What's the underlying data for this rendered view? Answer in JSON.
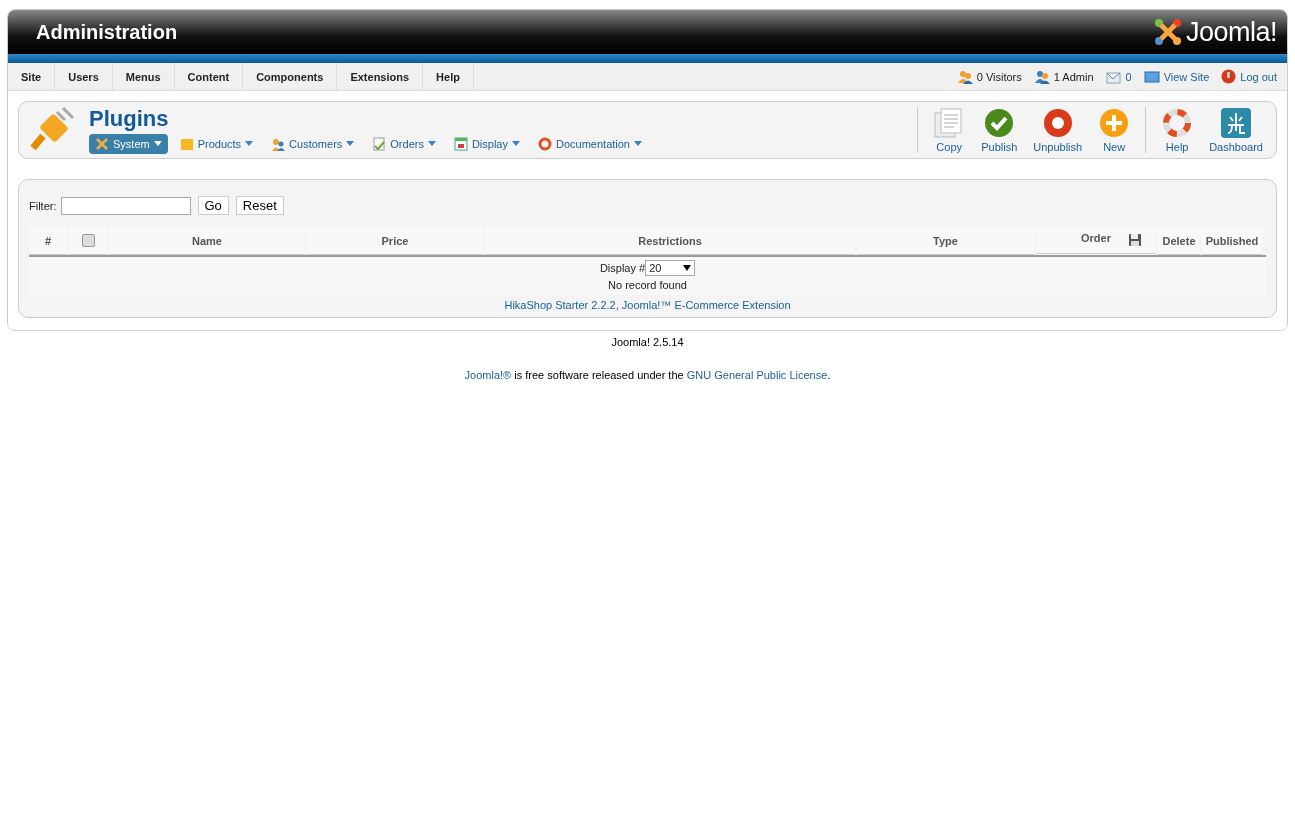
{
  "header": {
    "title": "Administration",
    "logo": "Joomla!"
  },
  "menu": [
    "Site",
    "Users",
    "Menus",
    "Content",
    "Components",
    "Extensions",
    "Help"
  ],
  "status": [
    {
      "kind": "visitors",
      "label": "0 Visitors",
      "link": false
    },
    {
      "kind": "admin",
      "label": "1 Admin",
      "link": false
    },
    {
      "kind": "messages",
      "label": "0",
      "link": true
    },
    {
      "kind": "viewsite",
      "label": "View Site",
      "link": true
    },
    {
      "kind": "logout",
      "label": "Log out",
      "link": true
    }
  ],
  "page_title": "Plugins",
  "submenu": [
    {
      "kind": "system",
      "label": "System",
      "selected": true
    },
    {
      "kind": "products",
      "label": "Products",
      "selected": false
    },
    {
      "kind": "customers",
      "label": "Customers",
      "selected": false
    },
    {
      "kind": "orders",
      "label": "Orders",
      "selected": false
    },
    {
      "kind": "display",
      "label": "Display",
      "selected": false
    },
    {
      "kind": "documentation",
      "label": "Documentation",
      "selected": false
    }
  ],
  "toolbar": [
    {
      "kind": "copy",
      "label": "Copy"
    },
    {
      "kind": "publish",
      "label": "Publish"
    },
    {
      "kind": "unpublish",
      "label": "Unpublish"
    },
    {
      "kind": "new",
      "label": "New"
    },
    {
      "kind": "help",
      "label": "Help"
    },
    {
      "kind": "dashboard",
      "label": "Dashboard"
    }
  ],
  "filter": {
    "label": "Filter:",
    "go": "Go",
    "reset": "Reset"
  },
  "table": {
    "columns": [
      "#",
      "",
      "Name",
      "Price",
      "Restrictions",
      "Type",
      "Order",
      "Delete",
      "Published"
    ],
    "select_all_checked": false
  },
  "display": {
    "label": "Display #",
    "value": "20"
  },
  "empty_message": "No record found",
  "credit": "HikaShop Starter 2.2.2, Joomla!™ E-Commerce Extension",
  "version": "Joomla! 2.5.14",
  "license": [
    {
      "text": "Joomla!®",
      "link": true
    },
    {
      "text": " is free software released under the ",
      "link": false
    },
    {
      "text": "GNU General Public License",
      "link": true
    },
    {
      "text": ".",
      "link": false
    }
  ]
}
